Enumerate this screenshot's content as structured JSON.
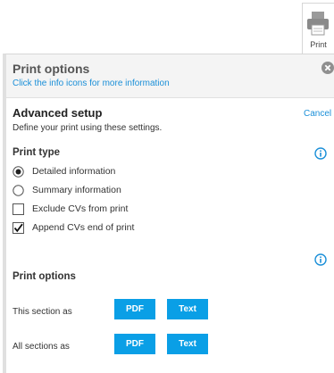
{
  "print_tab": {
    "label": "Print"
  },
  "header": {
    "title": "Print options",
    "subtitle": "Click the info icons for more information"
  },
  "advanced": {
    "title": "Advanced setup",
    "description": "Define your print using these settings.",
    "cancel_label": "Cancel"
  },
  "print_type": {
    "title": "Print type",
    "options": [
      {
        "label": "Detailed information",
        "type": "radio",
        "checked": true
      },
      {
        "label": "Summary information",
        "type": "radio",
        "checked": false
      },
      {
        "label": "Exclude CVs from print",
        "type": "checkbox",
        "checked": false
      },
      {
        "label": "Append CVs end of print",
        "type": "checkbox",
        "checked": true
      }
    ]
  },
  "print_options": {
    "title": "Print options",
    "rows": [
      {
        "label": "This section as",
        "pdf": "PDF",
        "text": "Text"
      },
      {
        "label": "All sections as",
        "pdf": "PDF",
        "text": "Text"
      }
    ]
  },
  "colors": {
    "accent": "#0a9fe6",
    "link": "#1a8fd8",
    "header_bg": "#f4f4f4"
  }
}
